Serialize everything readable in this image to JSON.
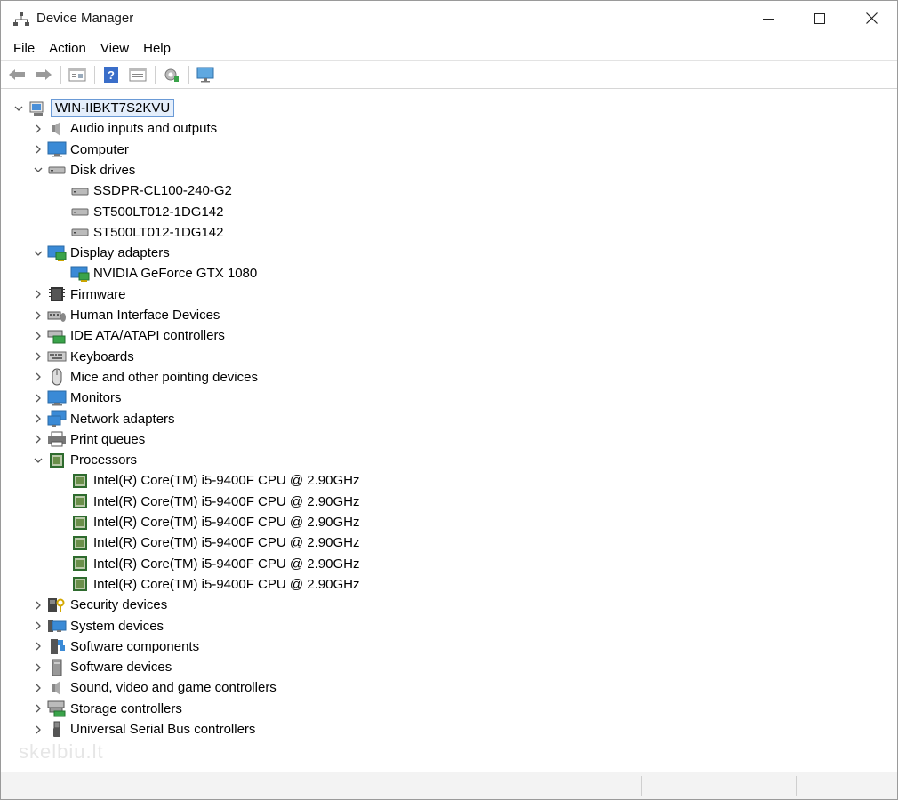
{
  "window": {
    "title": "Device Manager"
  },
  "menu": [
    "File",
    "Action",
    "View",
    "Help"
  ],
  "toolbar_icons": [
    "back-arrow-icon",
    "forward-arrow-icon",
    "properties-icon",
    "help-icon",
    "show-hidden-icon",
    "scan-hardware-icon",
    "monitor-icon"
  ],
  "tree": {
    "root": "WIN-IIBKT7S2KVU",
    "categories": [
      {
        "label": "Audio inputs and outputs",
        "icon": "speaker-icon",
        "expanded": false,
        "children": []
      },
      {
        "label": "Computer",
        "icon": "computer-icon",
        "expanded": false,
        "children": []
      },
      {
        "label": "Disk drives",
        "icon": "disk-drive-icon",
        "expanded": true,
        "children": [
          "SSDPR-CL100-240-G2",
          "ST500LT012-1DG142",
          "ST500LT012-1DG142"
        ]
      },
      {
        "label": "Display adapters",
        "icon": "display-adapter-icon",
        "expanded": true,
        "children": [
          "NVIDIA GeForce GTX 1080"
        ]
      },
      {
        "label": "Firmware",
        "icon": "firmware-icon",
        "expanded": false,
        "children": []
      },
      {
        "label": "Human Interface Devices",
        "icon": "hid-icon",
        "expanded": false,
        "children": []
      },
      {
        "label": "IDE ATA/ATAPI controllers",
        "icon": "ide-controller-icon",
        "expanded": false,
        "children": []
      },
      {
        "label": "Keyboards",
        "icon": "keyboard-icon",
        "expanded": false,
        "children": []
      },
      {
        "label": "Mice and other pointing devices",
        "icon": "mouse-icon",
        "expanded": false,
        "children": []
      },
      {
        "label": "Monitors",
        "icon": "monitor-icon",
        "expanded": false,
        "children": []
      },
      {
        "label": "Network adapters",
        "icon": "network-adapter-icon",
        "expanded": false,
        "children": []
      },
      {
        "label": "Print queues",
        "icon": "printer-icon",
        "expanded": false,
        "children": []
      },
      {
        "label": "Processors",
        "icon": "processor-icon",
        "expanded": true,
        "children": [
          "Intel(R) Core(TM) i5-9400F CPU @ 2.90GHz",
          "Intel(R) Core(TM) i5-9400F CPU @ 2.90GHz",
          "Intel(R) Core(TM) i5-9400F CPU @ 2.90GHz",
          "Intel(R) Core(TM) i5-9400F CPU @ 2.90GHz",
          "Intel(R) Core(TM) i5-9400F CPU @ 2.90GHz",
          "Intel(R) Core(TM) i5-9400F CPU @ 2.90GHz"
        ]
      },
      {
        "label": "Security devices",
        "icon": "security-device-icon",
        "expanded": false,
        "children": []
      },
      {
        "label": "System devices",
        "icon": "system-devices-icon",
        "expanded": false,
        "children": []
      },
      {
        "label": "Software components",
        "icon": "software-components-icon",
        "expanded": false,
        "children": []
      },
      {
        "label": "Software devices",
        "icon": "software-devices-icon",
        "expanded": false,
        "children": []
      },
      {
        "label": "Sound, video and game controllers",
        "icon": "speaker-icon",
        "expanded": false,
        "children": []
      },
      {
        "label": "Storage controllers",
        "icon": "storage-controller-icon",
        "expanded": false,
        "children": []
      },
      {
        "label": "Universal Serial Bus controllers",
        "icon": "usb-icon",
        "expanded": false,
        "children": []
      }
    ]
  },
  "watermark": "skelbiu.lt",
  "colors": {
    "selection_border": "#6a9ad6",
    "selection_fill": "#e4eefb",
    "accent_blue": "#3a8ad6"
  }
}
